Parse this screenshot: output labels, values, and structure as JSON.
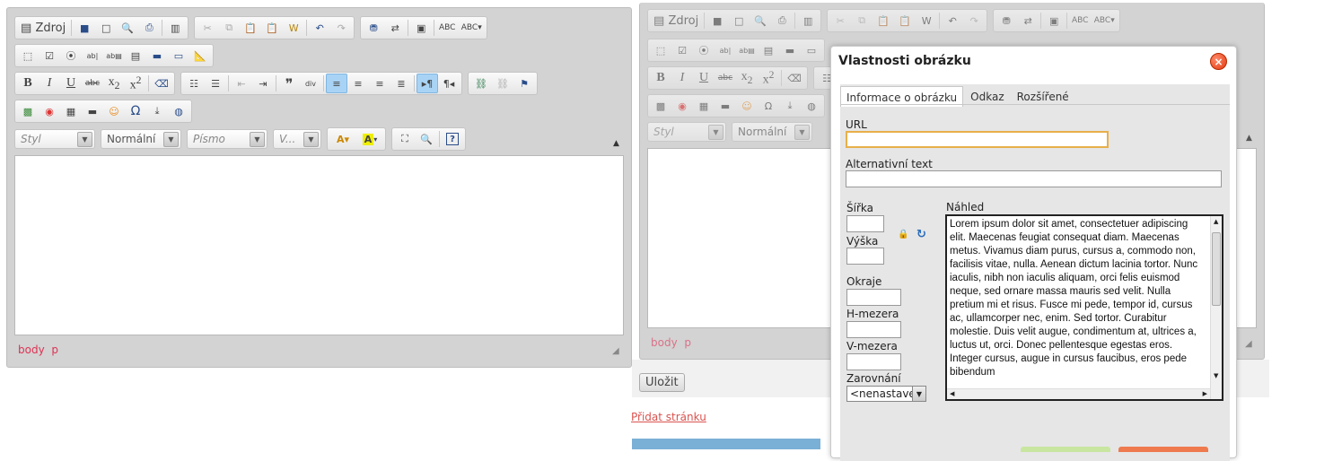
{
  "left_editor": {
    "toolbar": {
      "source_label": "Zdroj",
      "style_combo": "Styl",
      "format_combo": "Normální",
      "font_combo": "Písmo",
      "size_combo": "V...",
      "help_icon": "?"
    },
    "path": {
      "body": "body",
      "p": "p"
    }
  },
  "right_editor": {
    "toolbar": {
      "source_label": "Zdroj",
      "style_combo": "Styl",
      "format_combo": "Normální"
    },
    "path": {
      "body": "body",
      "p": "p"
    }
  },
  "page": {
    "save_button": "Uložit",
    "add_page_link": "Přidat stránku"
  },
  "dialog": {
    "title": "Vlastnosti obrázku",
    "close_symbol": "×",
    "tabs": [
      "Informace o obrázku",
      "Odkaz",
      "Rozšířené"
    ],
    "url_label": "URL",
    "url_value": "",
    "alt_label": "Alternativní text",
    "alt_value": "",
    "width_label": "Šířka",
    "height_label": "Výška",
    "border_label": "Okraje",
    "hspace_label": "H-mezera",
    "vspace_label": "V-mezera",
    "align_label": "Zarovnání",
    "align_value": "<nenastave",
    "preview_label": "Náhled",
    "preview_text": "Lorem ipsum dolor sit amet, consectetuer adipiscing elit. Maecenas feugiat consequat diam. Maecenas metus. Vivamus diam purus, cursus a, commodo non, facilisis vitae, nulla. Aenean dictum lacinia tortor. Nunc iaculis, nibh non iaculis aliquam, orci felis euismod neque, sed ornare massa mauris sed velit. Nulla pretium mi et risus. Fusce mi pede, tempor id, cursus ac, ullamcorper nec, enim. Sed tortor. Curabitur molestie. Duis velit augue, condimentum at, ultrices a, luctus ut, orci. Donec pellentesque egestas eros. Integer cursus, augue in cursus faucibus, eros pede bibendum"
  }
}
